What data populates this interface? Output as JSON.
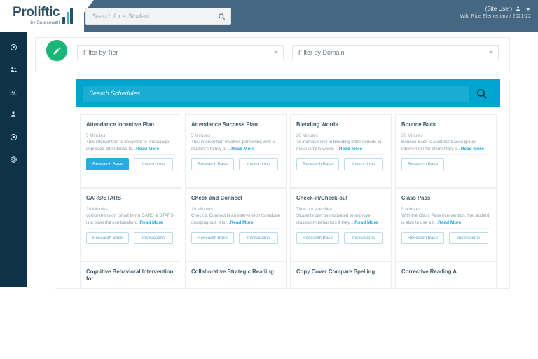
{
  "header": {
    "logo_main": "Proliftic",
    "logo_sub": "by Sourcewell",
    "search_placeholder": "Search for a Student",
    "search_value": "",
    "search_icon": "search-icon",
    "user_name": "| (Site User)",
    "user_icon": "person-icon",
    "user_caret_icon": "chevron-down-icon",
    "org_term": "Wild Rice Elementary / 2021-22",
    "bg_color": "#456781"
  },
  "sidebar": {
    "bg_color": "#0e3349",
    "items": [
      {
        "icon": "dashboard-gauge-icon",
        "name": "sidebar-item-dashboard"
      },
      {
        "icon": "group-people-icon",
        "name": "sidebar-item-groups"
      },
      {
        "icon": "chart-line-icon",
        "name": "sidebar-item-reports"
      },
      {
        "icon": "person-icon",
        "name": "sidebar-item-students"
      },
      {
        "icon": "target-circle-icon",
        "name": "sidebar-item-interventions"
      },
      {
        "icon": "settings-gear-icon",
        "name": "sidebar-item-settings"
      }
    ]
  },
  "filters": {
    "edit_icon": "pencil-edit-icon",
    "edit_color": "#18b776",
    "tier": {
      "label": "Filter by Tier",
      "caret_icon": "chevron-down-icon"
    },
    "domain": {
      "label": "Filter by Domain",
      "caret_icon": "chevron-down-icon"
    }
  },
  "schedules": {
    "search_placeholder": "Search Schedules",
    "search_value": "",
    "search_icon": "search-icon",
    "bar_color": "#00a5cf",
    "read_more_label": "Read More",
    "research_base_label": "Research Base",
    "instructions_label": "Instructions",
    "cards": [
      {
        "title": "Attendance Incentive Plan",
        "time": "5 Minutes",
        "desc": "This intervention is designed to encourage improved attendance fo...",
        "research_base": true,
        "research_base_primary": true,
        "instructions": true
      },
      {
        "title": "Attendance Success Plan",
        "time": "5 Minutes",
        "desc": "This intervention involves partnering with a student's family to ...",
        "research_base": true,
        "research_base_primary": false,
        "instructions": true
      },
      {
        "title": "Blending Words",
        "time": "20 Minutes",
        "desc": "To increase skill in blending letter sounds to make simple words ...",
        "research_base": true,
        "research_base_primary": false,
        "instructions": true
      },
      {
        "title": "Bounce Back",
        "time": "30 Minutes",
        "desc": "Bounce Back is a school-based group intervention for elementary s...",
        "research_base": true,
        "research_base_primary": false,
        "instructions": false
      },
      {
        "title": "CARS/STARS",
        "time": "20 Minutes",
        "desc": "comprehension (short term) CARS & STARS is a powerful combination...",
        "research_base": true,
        "research_base_primary": false,
        "instructions": true
      },
      {
        "title": "Check and Connect",
        "time": "10 Minutes",
        "desc": "Check & Connect is an intervention to reduce dropping out. It is ...",
        "research_base": true,
        "research_base_primary": false,
        "instructions": true
      },
      {
        "title": "Check-in/Check-out",
        "time": "Time not specified",
        "desc": "Students can be motivated to improve classroom behaviors if they ...",
        "research_base": true,
        "research_base_primary": false,
        "instructions": true
      },
      {
        "title": "Class Pass",
        "time": "5 Minutes",
        "desc": "With the Class Pass intervention, the student is able to use a li...",
        "research_base": true,
        "research_base_primary": false,
        "instructions": true
      },
      {
        "title": "Cognitive Behavioral Intervention for",
        "time": "",
        "desc": "",
        "research_base": false,
        "research_base_primary": false,
        "instructions": false
      },
      {
        "title": "Collaborative Strategic Reading",
        "time": "",
        "desc": "",
        "research_base": false,
        "research_base_primary": false,
        "instructions": false
      },
      {
        "title": "Copy Cover Compare Spelling",
        "time": "",
        "desc": "",
        "research_base": false,
        "research_base_primary": false,
        "instructions": false
      },
      {
        "title": "Corrective Reading A",
        "time": "",
        "desc": "",
        "research_base": false,
        "research_base_primary": false,
        "instructions": false
      }
    ]
  }
}
